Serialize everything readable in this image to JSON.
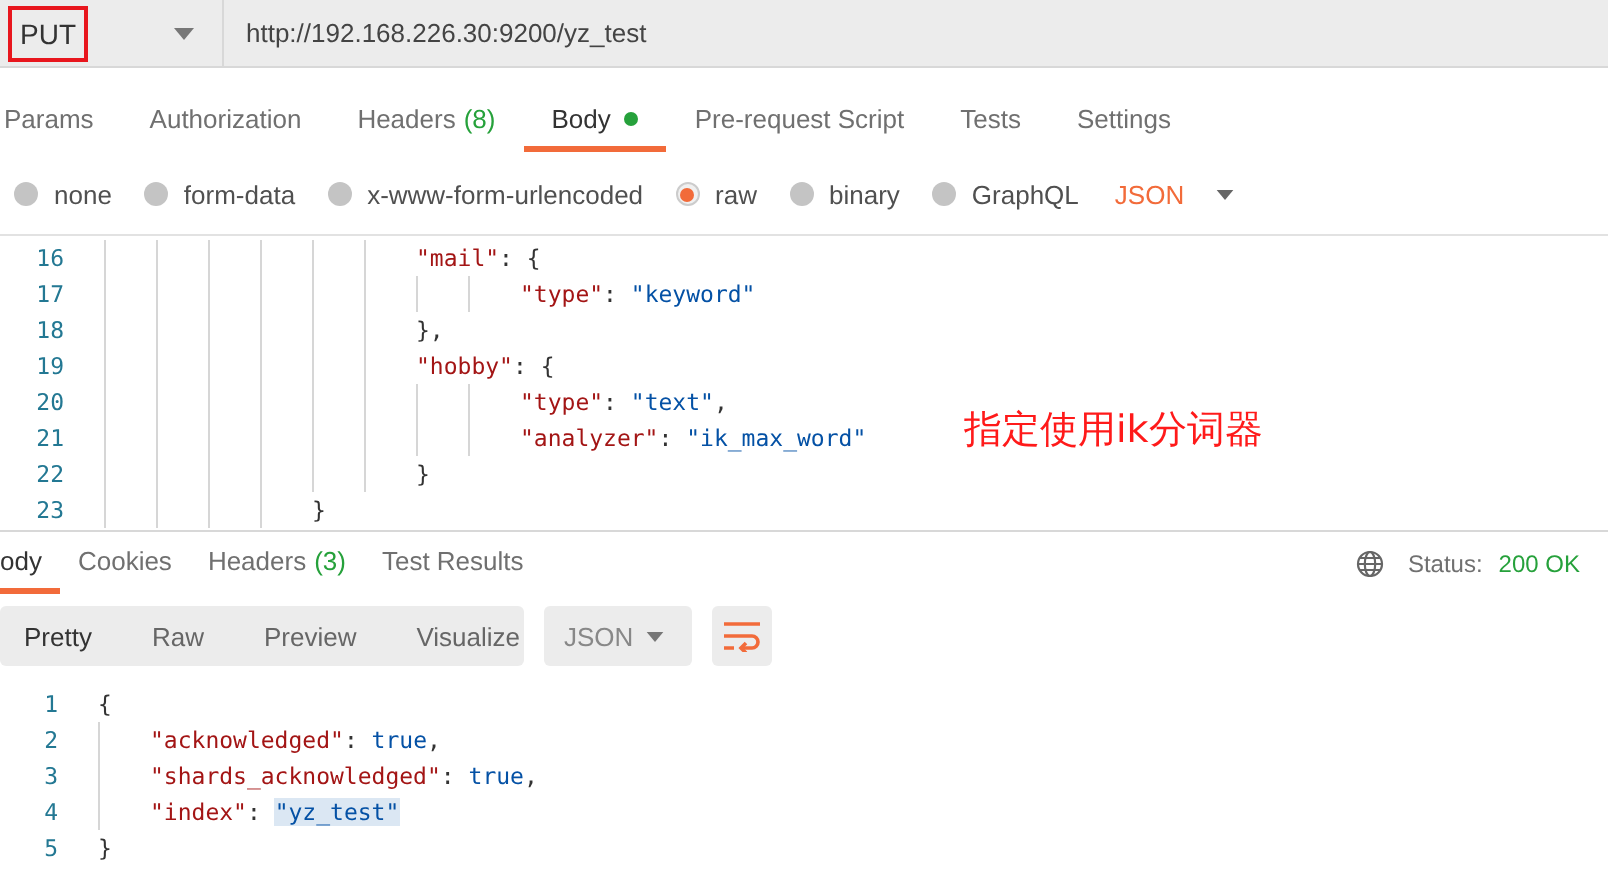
{
  "request": {
    "method": "PUT",
    "url": "http://192.168.226.30:9200/yz_test"
  },
  "request_tabs": [
    {
      "label": "Params",
      "selected": false
    },
    {
      "label": "Authorization",
      "selected": false
    },
    {
      "label": "Headers",
      "count": "(8)",
      "selected": false
    },
    {
      "label": "Body",
      "has_content": true,
      "selected": true
    },
    {
      "label": "Pre-request Script",
      "selected": false
    },
    {
      "label": "Tests",
      "selected": false
    },
    {
      "label": "Settings",
      "selected": false
    }
  ],
  "body_types": [
    {
      "label": "none",
      "selected": false
    },
    {
      "label": "form-data",
      "selected": false
    },
    {
      "label": "x-www-form-urlencoded",
      "selected": false
    },
    {
      "label": "raw",
      "selected": true
    },
    {
      "label": "binary",
      "selected": false
    },
    {
      "label": "GraphQL",
      "selected": false
    }
  ],
  "raw_format": "JSON",
  "request_body_lines": [
    {
      "number": "16",
      "tokens": [
        {
          "kind": "key",
          "text": "\t\t\t\t\t\t\"mail\""
        },
        {
          "kind": "punct",
          "text": ": {"
        }
      ]
    },
    {
      "number": "17",
      "tokens": [
        {
          "kind": "key",
          "text": "\t\t\t\t\t\t\t\t\"type\""
        },
        {
          "kind": "punct",
          "text": ": "
        },
        {
          "kind": "string",
          "text": "\"keyword\""
        }
      ]
    },
    {
      "number": "18",
      "tokens": [
        {
          "kind": "punct",
          "text": "\t\t\t\t\t\t},"
        }
      ]
    },
    {
      "number": "19",
      "tokens": [
        {
          "kind": "key",
          "text": "\t\t\t\t\t\t\"hobby\""
        },
        {
          "kind": "punct",
          "text": ": {"
        }
      ]
    },
    {
      "number": "20",
      "tokens": [
        {
          "kind": "key",
          "text": "\t\t\t\t\t\t\t\t\"type\""
        },
        {
          "kind": "punct",
          "text": ": "
        },
        {
          "kind": "string",
          "text": "\"text\""
        },
        {
          "kind": "punct",
          "text": ","
        }
      ]
    },
    {
      "number": "21",
      "tokens": [
        {
          "kind": "key",
          "text": "\t\t\t\t\t\t\t\t\"analyzer\""
        },
        {
          "kind": "punct",
          "text": ": "
        },
        {
          "kind": "string",
          "text": "\"ik_max_word\""
        }
      ]
    },
    {
      "number": "22",
      "tokens": [
        {
          "kind": "punct",
          "text": "\t\t\t\t\t\t}"
        }
      ]
    },
    {
      "number": "23",
      "tokens": [
        {
          "kind": "punct",
          "text": "\t\t\t\t}"
        }
      ]
    }
  ],
  "annotation": "指定使用ik分词器",
  "response_tabs": [
    {
      "label": "ody",
      "selected": true
    },
    {
      "label": "Cookies",
      "selected": false
    },
    {
      "label": "Headers",
      "count": "(3)",
      "selected": false
    },
    {
      "label": "Test Results",
      "selected": false
    }
  ],
  "status": {
    "label": "Status:",
    "value": "200 OK"
  },
  "view_modes": [
    {
      "label": "Pretty",
      "selected": true
    },
    {
      "label": "Raw",
      "selected": false
    },
    {
      "label": "Preview",
      "selected": false
    },
    {
      "label": "Visualize",
      "selected": false
    }
  ],
  "response_format": "JSON",
  "response_body_lines": [
    {
      "number": "1",
      "tokens": [
        {
          "kind": "punct",
          "text": "{"
        }
      ]
    },
    {
      "number": "2",
      "tokens": [
        {
          "kind": "key",
          "text": "\t\"acknowledged\""
        },
        {
          "kind": "punct",
          "text": ": "
        },
        {
          "kind": "bool",
          "text": "true"
        },
        {
          "kind": "punct",
          "text": ","
        }
      ]
    },
    {
      "number": "3",
      "tokens": [
        {
          "kind": "key",
          "text": "\t\"shards_acknowledged\""
        },
        {
          "kind": "punct",
          "text": ": "
        },
        {
          "kind": "bool",
          "text": "true"
        },
        {
          "kind": "punct",
          "text": ","
        }
      ]
    },
    {
      "number": "4",
      "tokens": [
        {
          "kind": "key",
          "text": "\t\"index\""
        },
        {
          "kind": "punct",
          "text": ": "
        },
        {
          "kind": "string",
          "text": "\"yz_test\"",
          "highlighted": true
        }
      ]
    },
    {
      "number": "5",
      "tokens": [
        {
          "kind": "punct",
          "text": "}"
        }
      ]
    }
  ]
}
